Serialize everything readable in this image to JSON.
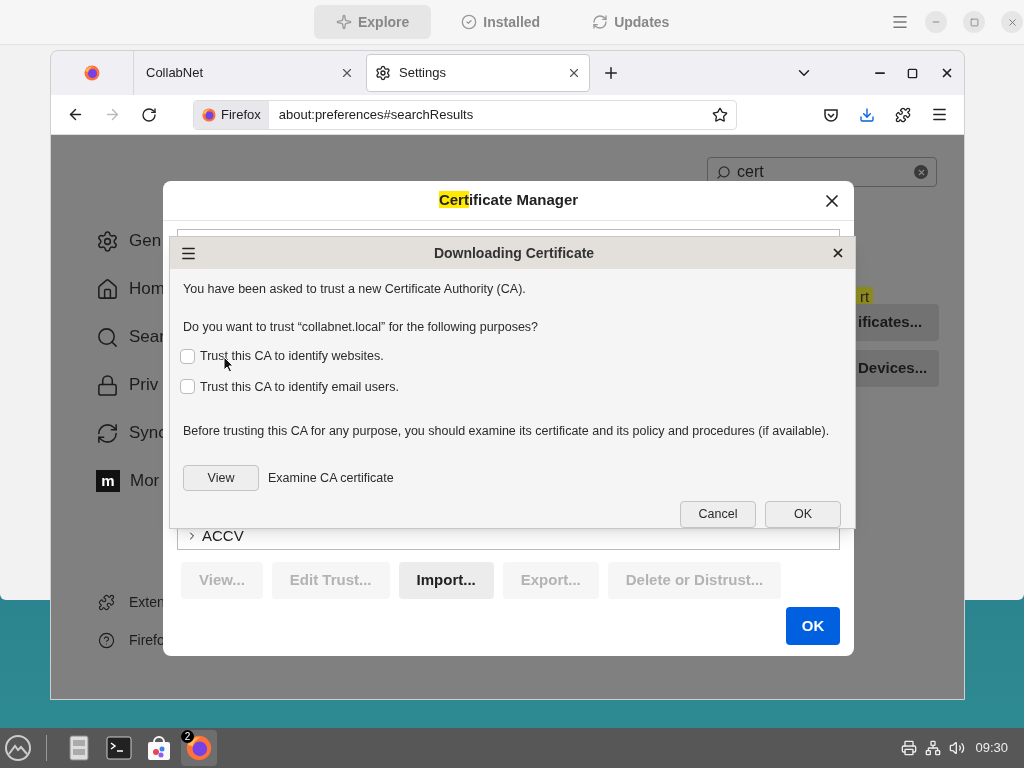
{
  "software_center": {
    "tabs": [
      {
        "label": "Explore",
        "kind": "explore",
        "selected": true
      },
      {
        "label": "Installed",
        "kind": "installed",
        "selected": false
      },
      {
        "label": "Updates",
        "kind": "updates",
        "selected": false
      }
    ]
  },
  "browser": {
    "tabs": [
      {
        "kind": "icon",
        "selected": false
      },
      {
        "kind": "page",
        "label": "CollabNet",
        "selected": false
      },
      {
        "kind": "settings",
        "label": "Settings",
        "selected": true
      }
    ],
    "identity": "Firefox",
    "url": "about:preferences#searchResults",
    "forward_disabled": true
  },
  "settings": {
    "search": "cert",
    "sidebar": [
      {
        "kind": "gear",
        "label": "Gen"
      },
      {
        "kind": "home",
        "label": "Hom"
      },
      {
        "kind": "search",
        "label": "Sear"
      },
      {
        "kind": "lock",
        "label": "Priv"
      },
      {
        "kind": "sync",
        "label": "Sync"
      },
      {
        "kind": "logo",
        "label": "Mor",
        "logo_letter": "m"
      }
    ],
    "footer": [
      {
        "kind": "puzzle",
        "label": "Exten"
      },
      {
        "kind": "help",
        "label": "Firefo"
      }
    ],
    "match_fragment": "rt",
    "buttons": [
      "ificates...",
      "Devices..."
    ]
  },
  "certificate_manager": {
    "title_match": "Cert",
    "title_rest": "ificate Manager",
    "list_rows": [
      "ACCV"
    ],
    "buttons": [
      {
        "label": "View...",
        "disabled": true
      },
      {
        "label": "Edit Trust...",
        "disabled": true
      },
      {
        "label": "Import...",
        "disabled": false
      },
      {
        "label": "Export...",
        "disabled": true
      },
      {
        "label": "Delete or Distrust...",
        "disabled": true
      }
    ],
    "ok": "OK"
  },
  "download_dialog": {
    "title": "Downloading Certificate",
    "intro": "You have been asked to trust a new Certificate Authority (CA).",
    "question": "Do you want to trust “collabnet.local” for the following purposes?",
    "options": [
      {
        "label": "Trust this CA to identify websites.",
        "checked": false
      },
      {
        "label": "Trust this CA to identify email users.",
        "checked": false
      }
    ],
    "note": "Before trusting this CA for any purpose, you should examine its certificate and its policy and procedures (if available).",
    "view_button": "View",
    "view_caption": "Examine CA certificate",
    "buttons": [
      "Cancel",
      "OK"
    ]
  },
  "taskbar": {
    "badge": "2",
    "clock": "09:30"
  }
}
